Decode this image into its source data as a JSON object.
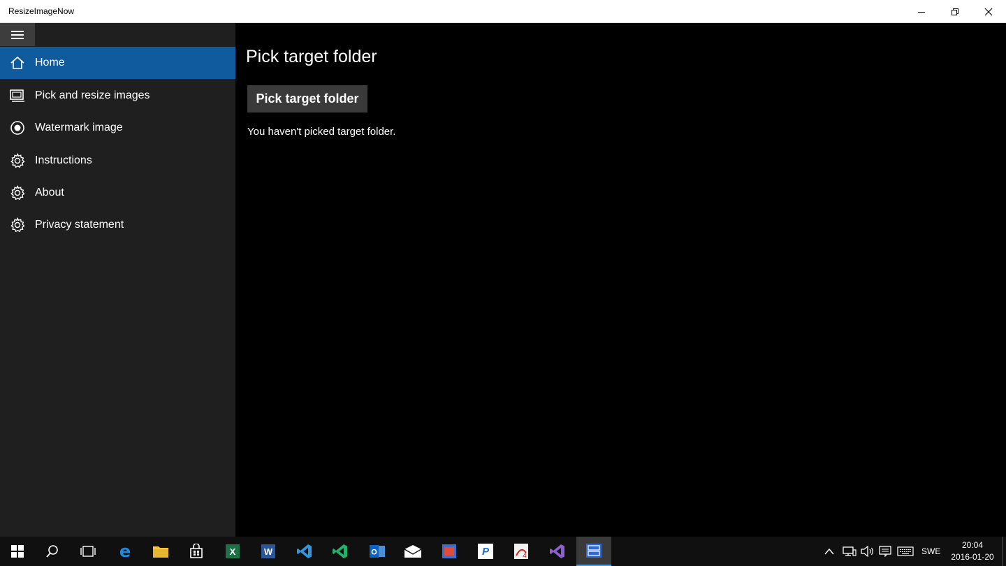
{
  "window": {
    "title": "ResizeImageNow"
  },
  "sidebar": {
    "items": [
      {
        "label": "Home",
        "icon": "home-icon",
        "active": true
      },
      {
        "label": "Pick and resize images",
        "icon": "images-icon",
        "active": false
      },
      {
        "label": "Watermark image",
        "icon": "radio-icon",
        "active": false
      },
      {
        "label": "Instructions",
        "icon": "gear-icon",
        "active": false
      },
      {
        "label": "About",
        "icon": "gear-icon",
        "active": false
      },
      {
        "label": "Privacy statement",
        "icon": "gear-icon",
        "active": false
      }
    ]
  },
  "main": {
    "title": "Pick target folder",
    "button_label": "Pick target folder",
    "status": "You haven't picked target folder."
  },
  "taskbar": {
    "apps": [
      "start",
      "search",
      "task-view",
      "edge",
      "file-explorer",
      "store",
      "excel",
      "word",
      "vs-code",
      "vs-code-insiders",
      "outlook",
      "mail",
      "app-red",
      "app-blue",
      "acrobat",
      "visual-studio",
      "resizeimagenow"
    ],
    "language": "SWE",
    "time": "20:04",
    "date": "2016-01-20"
  },
  "colors": {
    "accent": "#105b9e",
    "sidebar_bg": "#1f1f1f",
    "main_bg": "#000000",
    "button_bg": "#3a3a3a"
  }
}
